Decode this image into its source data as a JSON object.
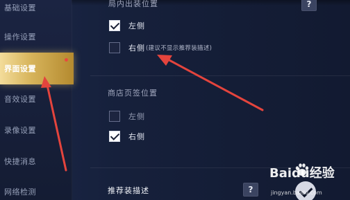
{
  "sidebar": {
    "items": [
      {
        "label": "基础设置",
        "active": false
      },
      {
        "label": "操作设置",
        "active": false
      },
      {
        "label": "界面设置",
        "active": true
      },
      {
        "label": "音效设置",
        "active": false
      },
      {
        "label": "录像设置",
        "active": false
      },
      {
        "label": "快捷消息",
        "active": false
      },
      {
        "label": "网络检测",
        "active": false
      }
    ]
  },
  "main": {
    "ingame_section": {
      "title": "局内出装位置",
      "help_label": "?",
      "options": [
        {
          "label": "左侧",
          "checked": true
        },
        {
          "label": "右侧",
          "note": "(建议不显示推荐装描述)",
          "checked": false
        }
      ]
    },
    "shop_section": {
      "title": "商店页签位置",
      "options": [
        {
          "label": "左侧",
          "checked": false
        },
        {
          "label": "右侧",
          "checked": true
        }
      ]
    },
    "recommend_section": {
      "title": "推荐装描述",
      "help_label": "?",
      "enabled": true
    }
  },
  "watermark": {
    "brand": "Baidu经验",
    "url": "jingyan.baidu.com"
  },
  "colors": {
    "active_tab": "#d7b45b",
    "arrow": "#e4443d",
    "background": "#16203b"
  }
}
